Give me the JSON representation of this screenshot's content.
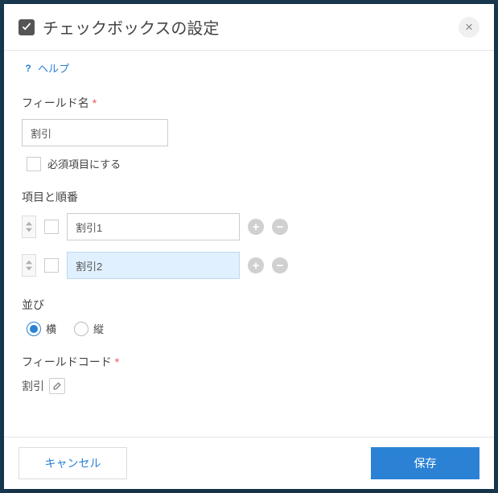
{
  "dialog": {
    "title": "チェックボックスの設定"
  },
  "help": {
    "label": "ヘルプ"
  },
  "field_name": {
    "label": "フィールド名",
    "value": "割引",
    "required_label": "必須項目にする",
    "required_checked": false
  },
  "options": {
    "label": "項目と順番",
    "items": [
      {
        "value": "割引1",
        "checked": false,
        "selected": false
      },
      {
        "value": "割引2",
        "checked": false,
        "selected": true
      }
    ]
  },
  "orientation": {
    "label": "並び",
    "choices": [
      {
        "label": "横",
        "checked": true
      },
      {
        "label": "縦",
        "checked": false
      }
    ]
  },
  "field_code": {
    "label": "フィールドコード",
    "value": "割引"
  },
  "footer": {
    "cancel": "キャンセル",
    "save": "保存"
  },
  "required_marker": "*"
}
